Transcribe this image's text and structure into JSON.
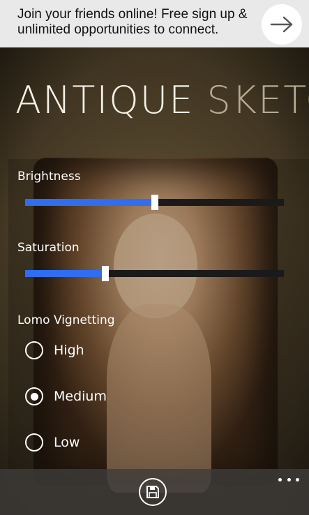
{
  "ad": {
    "line1": "Join your friends online! Free sign up &",
    "line2": "unlimited opportunities to connect.",
    "arrow_icon": "arrow-right-icon"
  },
  "header": {
    "title_main": "ANTIQUE",
    "title_secondary": "SKETC"
  },
  "controls": {
    "brightness": {
      "label": "Brightness",
      "value_fraction": 0.5
    },
    "saturation": {
      "label": "Saturation",
      "value_fraction": 0.31
    },
    "vignetting": {
      "label": "Lomo Vignetting",
      "options": [
        "High",
        "Medium",
        "Low"
      ],
      "selected": "Medium"
    }
  },
  "app_bar": {
    "save_icon": "save-icon",
    "more_icon": "more-icon"
  },
  "colors": {
    "accent": "#2f6df1",
    "ad_background": "#e9e9e9"
  }
}
